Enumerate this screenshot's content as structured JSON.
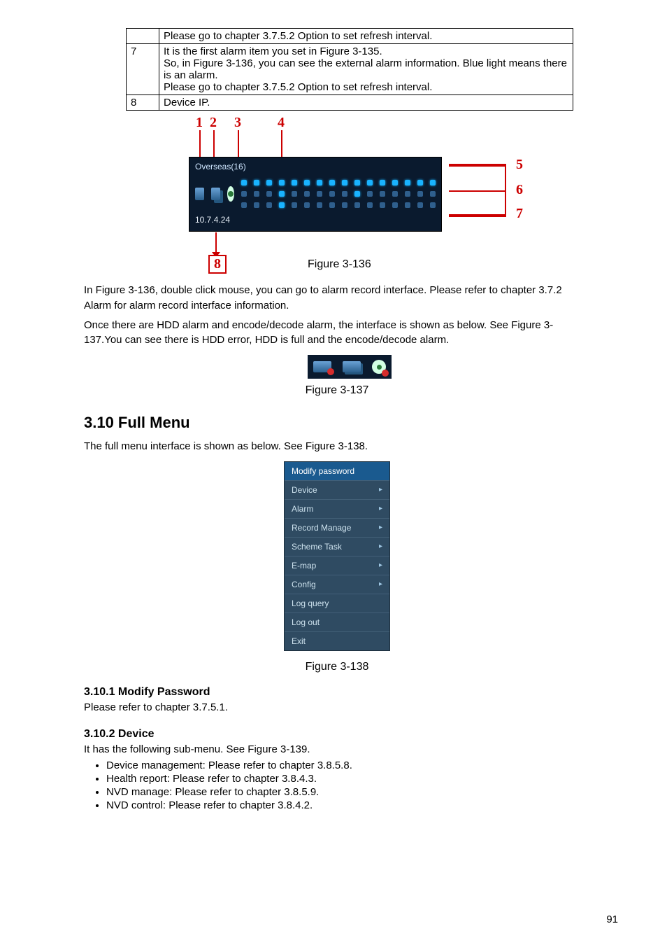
{
  "table": {
    "rows": [
      {
        "sn": "",
        "text": "Please go to chapter 3.7.5.2 Option to set refresh interval."
      },
      {
        "sn": "7",
        "text": "It is the first alarm item you set in Figure 3-135.\nSo, in Figure 3-136, you can see the external alarm information. Blue light means there is an alarm.\nPlease go to chapter 3.7.5.2 Option to set refresh interval."
      },
      {
        "sn": "8",
        "text": "Device IP."
      }
    ]
  },
  "fig136": {
    "device_name": "Overseas(16)",
    "device_ip": "10.7.4.24",
    "callouts": [
      "1",
      "2",
      "3",
      "4",
      "5",
      "6",
      "7",
      "8"
    ],
    "caption": "Figure 3-136"
  },
  "para": {
    "after_136": "In Figure 3-136, double click mouse, you can go to alarm record interface. Please refer to chapter 3.7.2 Alarm for alarm record interface information.",
    "after_136b": "Once there are HDD alarm and encode/decode alarm, the interface is shown as below. See Figure 3-137.You can see there is HDD error, HDD is full and the encode/decode alarm.",
    "full_menu_intro": "The full menu interface is shown as below. See Figure 3-138.",
    "modify_pw_text": "Please refer to chapter 3.7.5.1.",
    "device_intro": "It has the following sub-menu. See Figure 3-139."
  },
  "fig137": {
    "caption": "Figure 3-137"
  },
  "headings": {
    "full_menu": "3.10 Full Menu",
    "modify_pw": "3.10.1 Modify Password",
    "device": "3.10.2 Device"
  },
  "menu138": {
    "items": [
      {
        "label": "Modify password",
        "arrow": false,
        "top": true
      },
      {
        "label": "Device",
        "arrow": true
      },
      {
        "label": "Alarm",
        "arrow": true
      },
      {
        "label": "Record Manage",
        "arrow": true
      },
      {
        "label": "Scheme Task",
        "arrow": true
      },
      {
        "label": "E-map",
        "arrow": true
      },
      {
        "label": "Config",
        "arrow": true
      },
      {
        "label": "Log query",
        "arrow": false
      },
      {
        "label": "Log out",
        "arrow": false
      },
      {
        "label": "Exit",
        "arrow": false
      }
    ],
    "caption": "Figure 3-138"
  },
  "device_bullets": [
    "Device management: Please refer to chapter 3.8.5.8.",
    "Health report: Please refer to chapter 3.8.4.3.",
    "NVD manage: Please refer to chapter 3.8.5.9.",
    "NVD control: Please refer to chapter 3.8.4.2."
  ],
  "page_number": "91"
}
